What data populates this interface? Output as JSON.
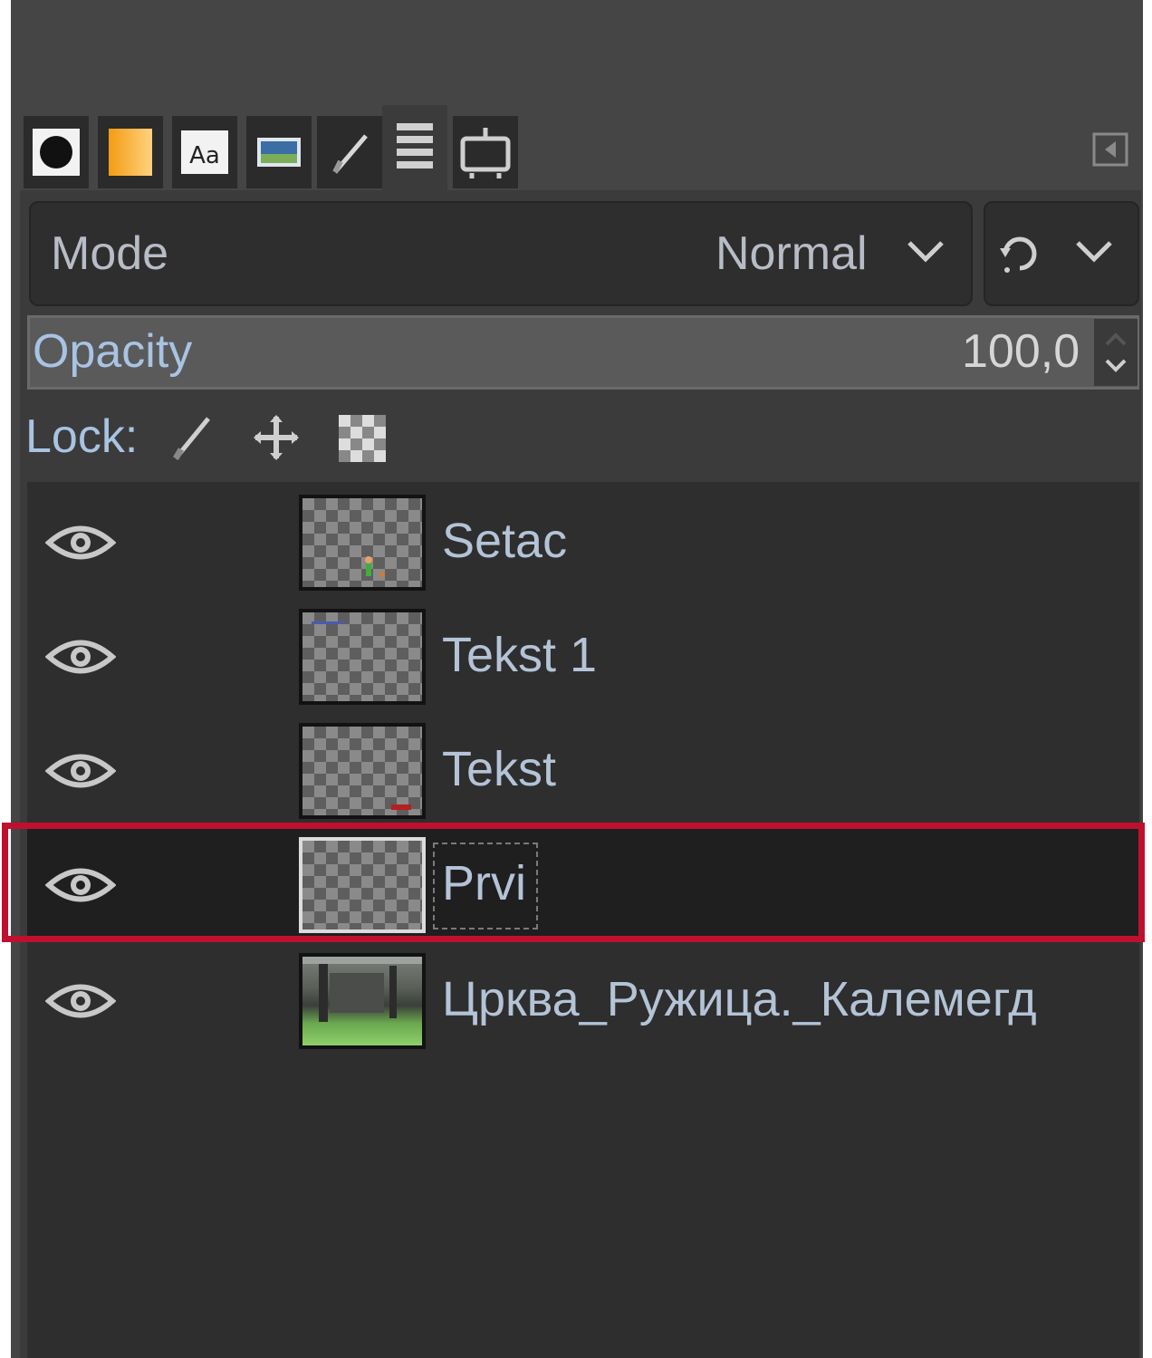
{
  "tabs": [
    {
      "name": "brushes",
      "icon": "brush-tip-icon"
    },
    {
      "name": "gradients",
      "icon": "gradient-icon"
    },
    {
      "name": "fonts",
      "icon": "fonts-icon",
      "text": "Aa"
    },
    {
      "name": "images",
      "icon": "images-icon"
    },
    {
      "name": "paths",
      "icon": "paths-icon"
    },
    {
      "name": "layers",
      "icon": "layers-icon",
      "active": true
    },
    {
      "name": "undo-history",
      "icon": "history-icon"
    }
  ],
  "mode": {
    "label": "Mode",
    "value": "Normal"
  },
  "opacity": {
    "label": "Opacity",
    "value": "100,0"
  },
  "lock": {
    "label": "Lock:",
    "icons": [
      "lock-pixels-icon",
      "lock-position-icon",
      "lock-alpha-icon"
    ]
  },
  "layers": [
    {
      "name": "Setac",
      "visible": true,
      "selected": false
    },
    {
      "name": "Tekst 1",
      "visible": true,
      "selected": false
    },
    {
      "name": "Tekst",
      "visible": true,
      "selected": false
    },
    {
      "name": "Prvi",
      "visible": true,
      "selected": true
    },
    {
      "name": "Црква_Ружица._Калемегд",
      "visible": true,
      "selected": false
    }
  ],
  "colors": {
    "highlight": "#c0102f",
    "panel": "#454545",
    "list": "#2e2e2e",
    "text": "#b4c3d6"
  }
}
